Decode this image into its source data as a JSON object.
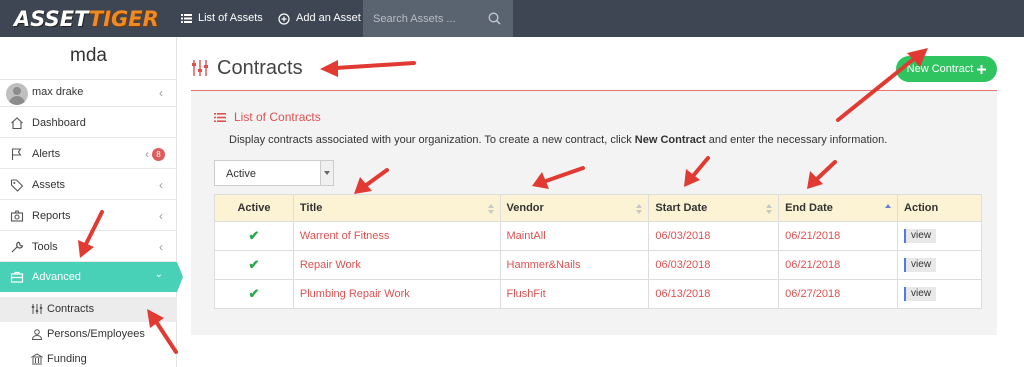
{
  "topbar": {
    "logo_part1": "ASSET",
    "logo_part2": "TIGER",
    "list_assets": "List of Assets",
    "add_asset": "Add an Asset",
    "search_placeholder": "Search Assets ..."
  },
  "sidebar": {
    "org": "mda",
    "user": "max drake",
    "items": [
      {
        "label": "Dashboard"
      },
      {
        "label": "Alerts",
        "badge": "8"
      },
      {
        "label": "Assets"
      },
      {
        "label": "Reports"
      },
      {
        "label": "Tools"
      },
      {
        "label": "Advanced"
      }
    ],
    "subitems": [
      {
        "label": "Contracts"
      },
      {
        "label": "Persons/Employees"
      },
      {
        "label": "Funding"
      }
    ]
  },
  "main": {
    "title": "Contracts",
    "new_button": "New Contract",
    "panel_title": "List of Contracts",
    "desc_pre": "Display contracts associated with your organization. To create a new contract, click ",
    "desc_bold": "New Contract",
    "desc_post": " and enter the necessary information.",
    "filter_value": "Active"
  },
  "table": {
    "headers": [
      "Active",
      "Title",
      "Vendor",
      "Start Date",
      "End Date",
      "Action"
    ],
    "rows": [
      {
        "title": "Warrent of Fitness",
        "vendor": "MaintAll",
        "start": "06/03/2018",
        "end": "06/21/2018",
        "action": "view"
      },
      {
        "title": "Repair Work",
        "vendor": "Hammer&Nails",
        "start": "06/03/2018",
        "end": "06/21/2018",
        "action": "view"
      },
      {
        "title": "Plumbing Repair Work",
        "vendor": "FlushFit",
        "start": "06/13/2018",
        "end": "06/27/2018",
        "action": "view"
      }
    ]
  },
  "colors": {
    "topbar": "#3d4652",
    "accent_teal": "#48d1b6",
    "accent_red": "#e05050",
    "button_green": "#2fc45f",
    "annotation_arrow": "#e03a32"
  },
  "icons": [
    "list-icon",
    "plus-circle-icon",
    "search-icon",
    "home-icon",
    "flag-icon",
    "tags-icon",
    "reports-icon",
    "wrench-icon",
    "briefcase-icon",
    "sliders-icon",
    "users-icon",
    "bank-icon",
    "check-icon",
    "plus-icon"
  ]
}
